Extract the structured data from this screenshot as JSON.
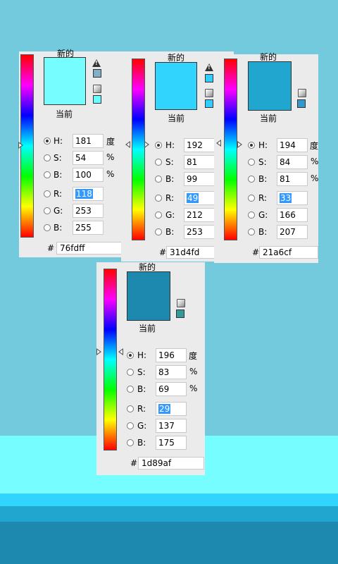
{
  "background": {
    "top": "#74cadd",
    "band1": "#76fdff",
    "band2": "#31d4fd",
    "band3": "#21a6cf",
    "band4": "#1d89af"
  },
  "labels": {
    "new": "新的",
    "current": "当前",
    "degree": "度",
    "percent": "%",
    "hash": "#",
    "warn": "!"
  },
  "pickers": [
    {
      "h": "181",
      "s": "54",
      "b": "100",
      "r": "118",
      "g": "253",
      "bl": "255",
      "hex": "76fdff",
      "color": "#76fdff"
    },
    {
      "h": "192",
      "s": "81",
      "b": "99",
      "r": "49",
      "g": "212",
      "bl": "253",
      "hex": "31d4fd",
      "color": "#31d4fd"
    },
    {
      "h": "194",
      "s": "84",
      "b": "81",
      "r": "33",
      "g": "166",
      "bl": "207",
      "hex": "21a6cf",
      "color": "#21a6cf"
    },
    {
      "h": "196",
      "s": "83",
      "b": "69",
      "r": "29",
      "g": "137",
      "bl": "175",
      "hex": "1d89af",
      "color": "#1d89af"
    }
  ],
  "field_labels": {
    "h": "H:",
    "s": "S:",
    "b": "B:",
    "r": "R:",
    "g": "G:",
    "bl": "B:"
  }
}
